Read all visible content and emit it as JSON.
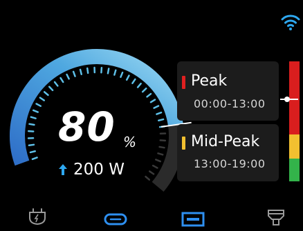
{
  "status": {
    "wifi": "wifi-icon"
  },
  "gauge": {
    "soc_percent": 80,
    "value_text": "80",
    "unit": "%",
    "power_text": "200 W",
    "power_direction_icon": "arrow-up-icon",
    "colors": {
      "arc_start": "#3a7fd0",
      "arc_end": "#8ad2f0",
      "track": "#2b2b2b",
      "ticks": "#5ec0e8"
    }
  },
  "tariff": {
    "periods": [
      {
        "name": "Peak",
        "time": "00:00-13:00",
        "color": "#e02020"
      },
      {
        "name": "Mid-Peak",
        "time": "13:00-19:00",
        "color": "#f2c030"
      }
    ],
    "strip_colors": [
      "#d91e1e",
      "#f2c030",
      "#33b34a"
    ]
  },
  "nav": {
    "items": [
      {
        "name": "nav-ac-outlet",
        "icon": "ac-plug-icon",
        "active": false
      },
      {
        "name": "nav-usb-c",
        "icon": "usb-c-icon",
        "active": true
      },
      {
        "name": "nav-usb-a",
        "icon": "usb-a-icon",
        "active": true
      },
      {
        "name": "nav-dc-output",
        "icon": "dc-port-icon",
        "active": false
      }
    ],
    "colors": {
      "active": "#2e8ff0",
      "inactive": "#9a9a9a"
    }
  }
}
